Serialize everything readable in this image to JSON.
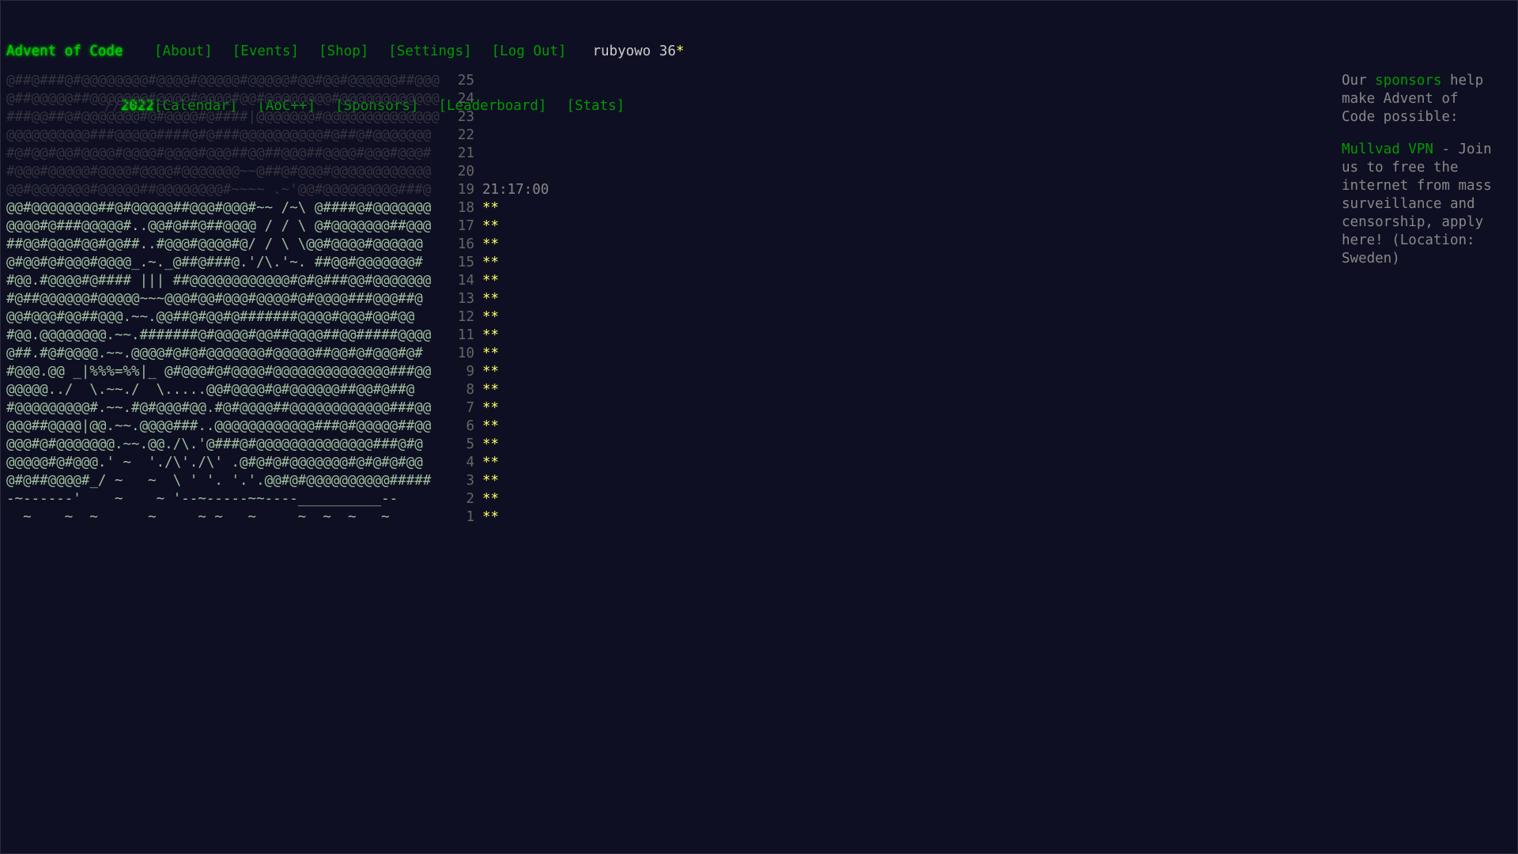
{
  "site": {
    "title": "Advent of Code",
    "event_slashes": "//",
    "event_year": "2022"
  },
  "nav_global": [
    "[About]",
    "[Events]",
    "[Shop]",
    "[Settings]",
    "[Log Out]"
  ],
  "user": {
    "name": "rubyowo",
    "stars": "36",
    "star_glyph": "*"
  },
  "nav_event": [
    "[Calendar]",
    "[AoC++]",
    "[Sponsors]",
    "[Leaderboard]",
    "[Stats]"
  ],
  "calendar": [
    {
      "art": "@##@###@#@@@@@@@@#@@@@#@@@@@#@@@@@#@@#@@#@@@@@@##@@@",
      "day": "25",
      "stars": "",
      "timer": ""
    },
    {
      "art": "@##@@@@@##@@@@@@@#@@@@#@@@@#@@#@@@@@@@@#@@@@@@@@@@@@",
      "day": "24",
      "stars": "",
      "timer": ""
    },
    {
      "art": "###@@##@#@@@@@@@#@#@@@@#@####|@@@@@@@#@@@@@@@@@@@@@@",
      "day": "23",
      "stars": "",
      "timer": ""
    },
    {
      "art": "@@@@@@@@@@###@@@@@####@#@###@@@@@@@@@@#@##@#@@@@@@@",
      "day": "22",
      "stars": "",
      "timer": ""
    },
    {
      "art": "#@#@@#@@#@@@@#@@@@#@@@@#@@@##@@##@@@##@@@@#@@@#@@@#",
      "day": "21",
      "stars": "",
      "timer": ""
    },
    {
      "art": "#@@@#@@@@@#@@@@#@@@@#@@@@@@@~~@##@#@@@#@@@@@@@@@@@@",
      "day": "20",
      "stars": "",
      "timer": ""
    },
    {
      "art": "@@#@@@@@@@#@@@@@##@@@@@@@@#~~~~ .~'@@#@@@@@@@@@###@",
      "day": "19",
      "stars": "",
      "timer": "21:17:00"
    },
    {
      "art": "@@#@@@@@@@@##@#@@@@@##@@@#@@@#~~ /~\\ @####@#@@@@@@@",
      "day": "18",
      "stars": "**",
      "timer": ""
    },
    {
      "art": "@@@@#@###@@@@@#..@@#@##@##@@@@ / / \\ @#@@@@@@@##@@@",
      "day": "17",
      "stars": "**",
      "timer": ""
    },
    {
      "art": "##@@#@@@#@@#@@##..#@@@#@@@@#@/ / \\ \\@@#@@@@#@@@@@@",
      "day": "16",
      "stars": "**",
      "timer": ""
    },
    {
      "art": "@#@@#@#@@@#@@@@_.~._@##@###@.'/\\.'~. ##@@#@@@@@@@#",
      "day": "15",
      "stars": "**",
      "timer": ""
    },
    {
      "art": "#@@.#@@@@#@#### ||| ##@@@@@@@@@@@@#@#@###@@#@@@@@@@",
      "day": "14",
      "stars": "**",
      "timer": ""
    },
    {
      "art": "#@##@@@@@@#@@@@@~~~@@@#@@#@@@#@@@@#@#@@@@###@@@##@",
      "day": "13",
      "stars": "**",
      "timer": ""
    },
    {
      "art": "@@#@@@#@@##@@@.~~.@@##@#@@#@#######@@@@#@@@#@@#@@",
      "day": "12",
      "stars": "**",
      "timer": ""
    },
    {
      "art": "#@@.@@@@@@@@.~~.#######@#@@@@#@@##@@@@##@@#####@@@@",
      "day": "11",
      "stars": "**",
      "timer": ""
    },
    {
      "art": "@##.#@#@@@@.~~.@@@@#@#@#@@@@@@@#@@@@@##@@#@#@@@#@#",
      "day": "10",
      "stars": "**",
      "timer": ""
    },
    {
      "art": "#@@@.@@ _|%%%=%%|_ @#@@@#@#@@@@#@@@@@@@@@@@@@@###@@",
      "day": "9",
      "stars": "**",
      "timer": ""
    },
    {
      "art": "@@@@@../  \\.~~./  \\.....@@#@@@@#@#@@@@@@##@@#@##@",
      "day": "8",
      "stars": "**",
      "timer": ""
    },
    {
      "art": "#@@@@@@@@@#.~~.#@#@@@#@@.#@#@@@@##@@@@@@@@@@@@###@@",
      "day": "7",
      "stars": "**",
      "timer": ""
    },
    {
      "art": "@@@##@@@@|@@.~~.@@@@###..@@@@@@@@@@@@###@#@@@@@##@@",
      "day": "6",
      "stars": "**",
      "timer": ""
    },
    {
      "art": "@@@#@#@@@@@@@.~~.@@./\\.'@###@#@@@@@@@@@@@@@@###@#@",
      "day": "5",
      "stars": "**",
      "timer": ""
    },
    {
      "art": "@@@@@#@#@@@.' ~  './\\'./\\' .@#@#@#@@@@@@@#@#@#@#@@",
      "day": "4",
      "stars": "**",
      "timer": ""
    },
    {
      "art": "@#@##@@@@#_/ ~   ~  \\ ' '. '.'.@@#@#@@@@@@@@@@#####",
      "day": "3",
      "stars": "**",
      "timer": ""
    },
    {
      "art": "-~------'    ~    ~ '--~-----~~----__________--",
      "day": "2",
      "stars": "**",
      "timer": ""
    },
    {
      "art": "  ~    ~  ~      ~     ~ ~   ~     ~  ~  ~   ~",
      "day": "1",
      "stars": "**",
      "timer": ""
    }
  ],
  "sidebar": {
    "intro_pre": "Our ",
    "intro_link": "sponsors",
    "intro_post": " help make Advent of Code possible:",
    "sponsor_name": "Mullvad VPN",
    "sponsor_text": " - Join us to free the internet from mass surveillance and censorship, apply here! (Location: Sweden)"
  },
  "colors": {
    "background": "#0f0f23",
    "link": "#009900",
    "star": "#ffff66",
    "text": "#cccccc"
  }
}
